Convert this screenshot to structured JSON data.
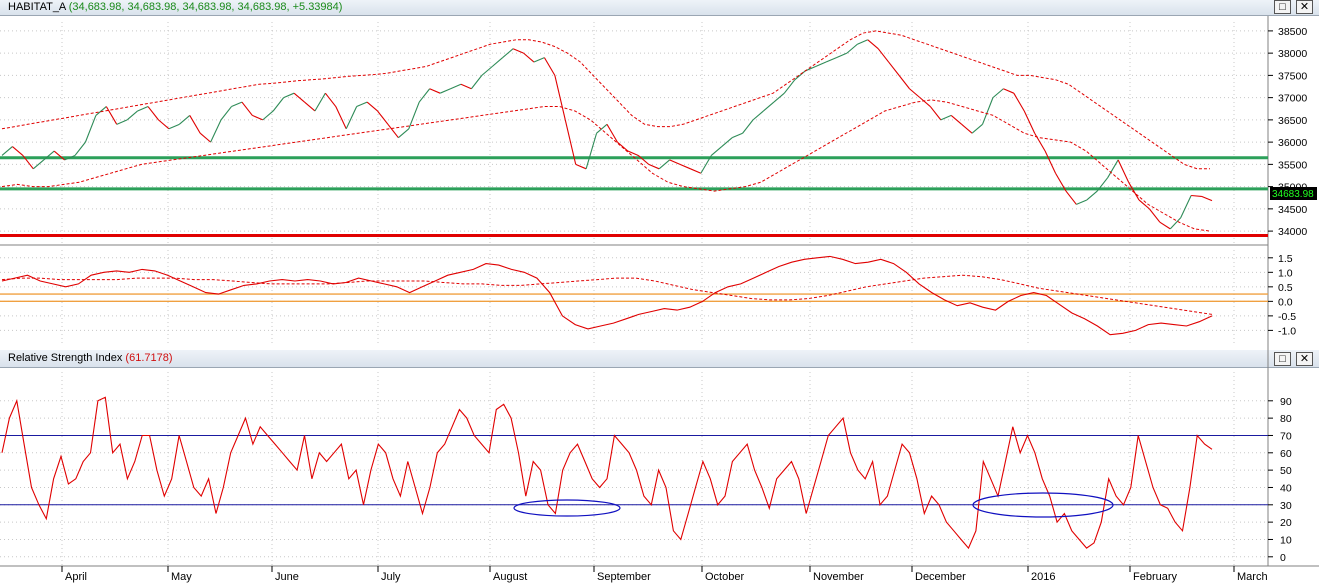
{
  "windows": {
    "price": {
      "name": "HABITAT_A",
      "values": "(34,683.98, 34,683.98, 34,683.98, 34,683.98, +5.33984)"
    },
    "rsi": {
      "name": "Relative Strength Index",
      "values": "(61.7178)"
    }
  },
  "window_buttons": {
    "restore": "□",
    "close": "✕"
  },
  "last_price_label": "34683.98",
  "colors": {
    "price_up": "#2e8b57",
    "price_down": "#e00000",
    "band": "#e00000",
    "support_green": "#2ca05a",
    "support_red": "#e00000",
    "oscillator_ref": "#f0a040",
    "rsi_ref": "#1a1aa0",
    "ellipse": "#1010c0",
    "grid": "#c8c8c8",
    "last_label_bg": "#000000",
    "last_label_fg": "#22ff22"
  },
  "x_axis": {
    "labels": [
      "April",
      "May",
      "June",
      "July",
      "August",
      "September",
      "October",
      "November",
      "December",
      "2016",
      "February",
      "March"
    ]
  },
  "chart_data": [
    {
      "type": "line",
      "panel": "price",
      "ylim": [
        33800,
        38700
      ],
      "y_ticks": [
        34000,
        34500,
        35000,
        35500,
        36000,
        36500,
        37000,
        37500,
        38000,
        38500
      ],
      "horizontal_lines": [
        35650,
        34950,
        33900
      ],
      "series": [
        {
          "values": [
            35700,
            35900,
            35700,
            35400,
            35600,
            35800,
            35600,
            35700,
            36000,
            36600,
            36800,
            36400,
            36500,
            36700,
            36800,
            36500,
            36300,
            36400,
            36600,
            36200,
            36000,
            36500,
            36800,
            36900,
            36600,
            36500,
            36700,
            37000,
            37100,
            36900,
            36700,
            37100,
            36800,
            36300,
            36800,
            36900,
            36700,
            36400,
            36100,
            36300,
            36900,
            37200,
            37100,
            37200,
            37300,
            37200,
            37500,
            37700,
            37900,
            38100,
            38000,
            37800,
            37900,
            37500,
            36500,
            35500,
            35400,
            36200,
            36400,
            36000,
            35800,
            35700,
            35500,
            35400,
            35600,
            35500,
            35400,
            35300,
            35700,
            35900,
            36100,
            36200,
            36500,
            36700,
            36900,
            37100,
            37400,
            37600,
            37700,
            37800,
            37900,
            38000,
            38200,
            38300,
            38100,
            37800,
            37500,
            37200,
            37000,
            36800,
            36500,
            36600,
            36400,
            36200,
            36400,
            37000,
            37200,
            37100,
            36700,
            36200,
            35800,
            35300,
            34900,
            34600,
            34700,
            34900,
            35200,
            35600,
            35100,
            34700,
            34500,
            34200,
            34050,
            34300,
            34800,
            34780,
            34684
          ]
        },
        {
          "values": [
            36300,
            36350,
            36400,
            36450,
            36500,
            36550,
            36600,
            36650,
            36700,
            36750,
            36800,
            36850,
            36900,
            36950,
            37000,
            37050,
            37100,
            37150,
            37200,
            37250,
            37300,
            37320,
            37350,
            37380,
            37400,
            37420,
            37450,
            37480,
            37500,
            37520,
            37550,
            37600,
            37650,
            37700,
            37800,
            37900,
            38000,
            38100,
            38200,
            38250,
            38300,
            38300,
            38250,
            38150,
            38000,
            37800,
            37500,
            37200,
            36900,
            36600,
            36400,
            36350,
            36350,
            36400,
            36500,
            36600,
            36700,
            36800,
            36900,
            37000,
            37100,
            37300,
            37500,
            37700,
            37900,
            38100,
            38300,
            38450,
            38500,
            38450,
            38400,
            38300,
            38200,
            38100,
            38000,
            37900,
            37800,
            37700,
            37600,
            37500,
            37500,
            37450,
            37400,
            37300,
            37100,
            36900,
            36700,
            36500,
            36300,
            36100,
            35900,
            35700,
            35500,
            35400,
            35400
          ]
        },
        {
          "values": [
            35000,
            35050,
            35000,
            35000,
            35050,
            35100,
            35200,
            35300,
            35400,
            35500,
            35550,
            35600,
            35650,
            35700,
            35750,
            35800,
            35850,
            35900,
            35950,
            36000,
            36050,
            36100,
            36150,
            36200,
            36250,
            36300,
            36350,
            36400,
            36450,
            36500,
            36550,
            36600,
            36650,
            36700,
            36750,
            36800,
            36800,
            36700,
            36500,
            36200,
            35900,
            35600,
            35300,
            35100,
            35000,
            34950,
            34900,
            34950,
            35000,
            35100,
            35300,
            35500,
            35700,
            35900,
            36100,
            36300,
            36500,
            36700,
            36800,
            36900,
            36950,
            36900,
            36800,
            36700,
            36600,
            36400,
            36200,
            36100,
            36050,
            36000,
            35800,
            35500,
            35200,
            34900,
            34600,
            34400,
            34200,
            34050,
            34000
          ]
        }
      ]
    },
    {
      "type": "line",
      "panel": "oscillator",
      "ylim": [
        -1.4,
        1.7
      ],
      "y_ticks": [
        -1.0,
        -0.5,
        0.0,
        0.5,
        1.0,
        1.5
      ],
      "horizontal_lines": [
        0.25,
        0.0
      ],
      "series": [
        {
          "values": [
            0.7,
            0.8,
            0.9,
            0.7,
            0.6,
            0.5,
            0.6,
            0.9,
            1.0,
            1.05,
            1.0,
            1.1,
            1.05,
            0.9,
            0.7,
            0.5,
            0.3,
            0.25,
            0.4,
            0.55,
            0.6,
            0.7,
            0.75,
            0.7,
            0.75,
            0.7,
            0.6,
            0.65,
            0.8,
            0.7,
            0.6,
            0.5,
            0.3,
            0.5,
            0.7,
            0.9,
            1.0,
            1.1,
            1.3,
            1.25,
            1.1,
            1.0,
            0.8,
            0.3,
            -0.5,
            -0.8,
            -0.95,
            -0.85,
            -0.75,
            -0.6,
            -0.45,
            -0.35,
            -0.25,
            -0.3,
            -0.2,
            0.0,
            0.3,
            0.5,
            0.6,
            0.8,
            1.0,
            1.2,
            1.35,
            1.45,
            1.5,
            1.55,
            1.45,
            1.3,
            1.35,
            1.45,
            1.3,
            1.0,
            0.6,
            0.3,
            0.05,
            -0.15,
            -0.05,
            -0.2,
            -0.3,
            0.0,
            0.2,
            0.3,
            0.2,
            -0.1,
            -0.4,
            -0.6,
            -0.85,
            -1.15,
            -1.1,
            -1.0,
            -0.8,
            -0.75,
            -0.8,
            -0.85,
            -0.7,
            -0.5
          ]
        },
        {
          "values": [
            0.75,
            0.8,
            0.8,
            0.75,
            0.75,
            0.75,
            0.75,
            0.8,
            0.8,
            0.8,
            0.75,
            0.75,
            0.7,
            0.65,
            0.6,
            0.6,
            0.6,
            0.6,
            0.65,
            0.7,
            0.7,
            0.7,
            0.7,
            0.65,
            0.6,
            0.6,
            0.55,
            0.55,
            0.6,
            0.65,
            0.7,
            0.75,
            0.8,
            0.8,
            0.7,
            0.55,
            0.4,
            0.3,
            0.2,
            0.1,
            0.05,
            0.05,
            0.1,
            0.2,
            0.35,
            0.5,
            0.6,
            0.7,
            0.8,
            0.85,
            0.9,
            0.85,
            0.75,
            0.6,
            0.45,
            0.35,
            0.25,
            0.15,
            0.05,
            -0.05,
            -0.15,
            -0.25,
            -0.35,
            -0.45
          ]
        }
      ]
    },
    {
      "type": "line",
      "panel": "rsi",
      "ylim": [
        -3,
        102
      ],
      "y_ticks": [
        0,
        10,
        20,
        30,
        40,
        50,
        60,
        70,
        80,
        90
      ],
      "horizontal_lines": [
        70,
        30
      ],
      "series": [
        {
          "values": [
            60,
            80,
            90,
            65,
            40,
            30,
            22,
            45,
            58,
            42,
            45,
            55,
            60,
            90,
            92,
            60,
            65,
            45,
            55,
            70,
            70,
            50,
            35,
            45,
            70,
            55,
            40,
            35,
            45,
            25,
            40,
            60,
            70,
            80,
            65,
            75,
            70,
            65,
            60,
            55,
            50,
            70,
            45,
            60,
            55,
            60,
            65,
            45,
            50,
            30,
            50,
            65,
            60,
            45,
            35,
            55,
            40,
            25,
            40,
            60,
            65,
            75,
            85,
            80,
            70,
            65,
            60,
            85,
            88,
            80,
            60,
            35,
            55,
            50,
            30,
            25,
            50,
            60,
            65,
            55,
            45,
            40,
            45,
            70,
            65,
            60,
            50,
            35,
            30,
            50,
            40,
            15,
            10,
            25,
            40,
            55,
            45,
            30,
            35,
            55,
            60,
            65,
            50,
            40,
            28,
            45,
            50,
            55,
            45,
            25,
            40,
            55,
            70,
            75,
            80,
            60,
            50,
            45,
            55,
            30,
            35,
            50,
            65,
            60,
            45,
            25,
            35,
            30,
            20,
            15,
            10,
            5,
            15,
            55,
            45,
            35,
            55,
            75,
            60,
            70,
            60,
            45,
            35,
            20,
            25,
            15,
            10,
            5,
            8,
            20,
            45,
            35,
            30,
            40,
            70,
            55,
            40,
            30,
            28,
            20,
            15,
            40,
            70,
            65,
            62
          ]
        }
      ]
    }
  ]
}
